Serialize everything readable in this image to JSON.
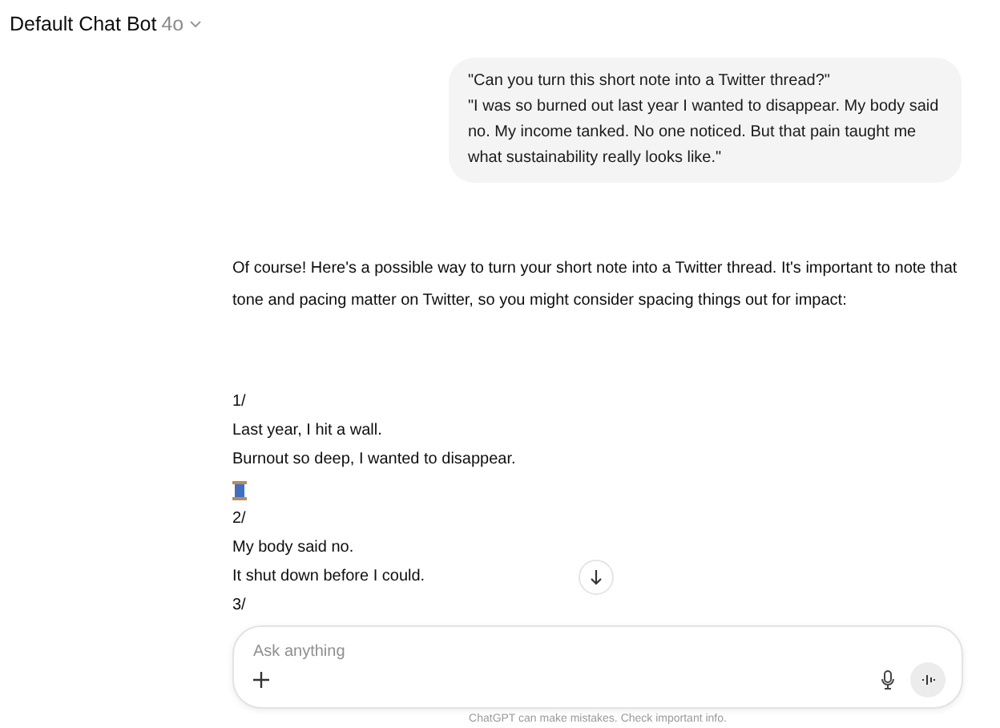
{
  "header": {
    "title": "Default Chat Bot",
    "model": "4o"
  },
  "user_message": {
    "paragraphs": [
      "\"Can you turn this short note into a Twitter thread?\"",
      "\"I was so burned out last year I wanted to disappear. My body said no. My income tanked. No one noticed. But that pain taught me what sustainability really looks like.\""
    ]
  },
  "assistant_message": {
    "intro": "Of course! Here's a possible way to turn your short note into a Twitter thread. It's important to note that tone and pacing matter on Twitter, so you might consider spacing things out for impact:",
    "thread": [
      {
        "kind": "number",
        "text": "1/"
      },
      {
        "kind": "line",
        "text": "Last year, I hit a wall."
      },
      {
        "kind": "line",
        "text": "Burnout so deep, I wanted to disappear."
      },
      {
        "kind": "spool"
      },
      {
        "kind": "number",
        "text": "2/"
      },
      {
        "kind": "line",
        "text": "My body said no."
      },
      {
        "kind": "line",
        "text": "It shut down before I could."
      },
      {
        "kind": "number",
        "text": "3/"
      }
    ]
  },
  "composer": {
    "placeholder": "Ask anything"
  },
  "footer": {
    "text": "ChatGPT can make mistakes. Check important info."
  }
}
